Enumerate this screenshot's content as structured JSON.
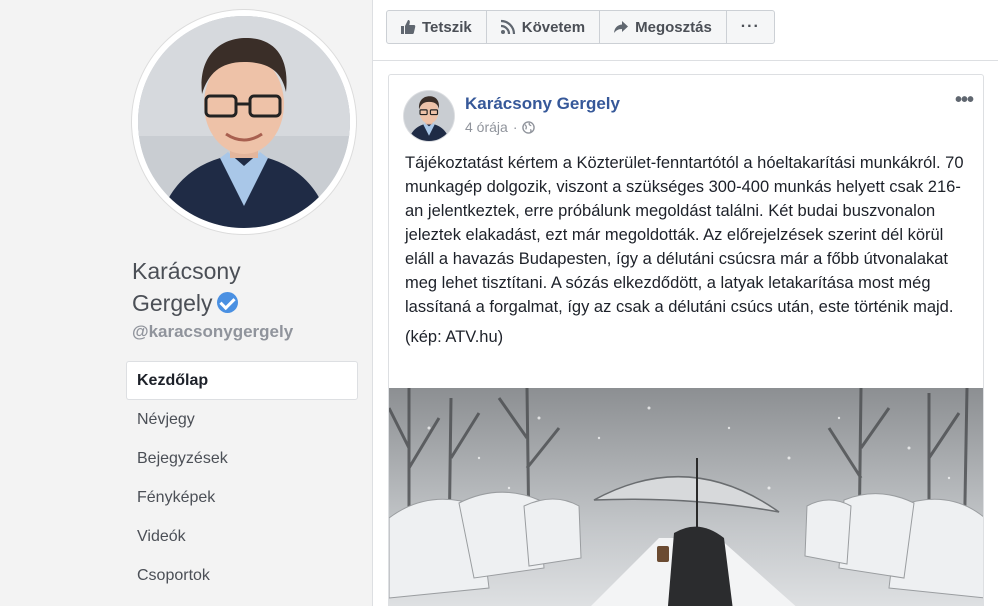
{
  "profile": {
    "name_line1": "Karácsony",
    "name_line2": "Gergely",
    "handle": "@karacsonygergely"
  },
  "nav": {
    "items": [
      {
        "label": "Kezdőlap",
        "active": true
      },
      {
        "label": "Névjegy"
      },
      {
        "label": "Bejegyzések"
      },
      {
        "label": "Fényképek"
      },
      {
        "label": "Videók"
      },
      {
        "label": "Csoportok"
      }
    ]
  },
  "actions": {
    "like": "Tetszik",
    "follow": "Követem",
    "share": "Megosztás",
    "more": "···"
  },
  "post": {
    "author": "Karácsony Gergely",
    "time": "4 órája",
    "separator": "·",
    "body": "Tájékoztatást kértem a Közterület-fenntartótól a hóeltakarítási munkákról. 70 munkagép dolgozik, viszont a szükséges 300-400 munkás helyett csak 216-an jelentkeztek, erre próbálunk megoldást találni. Két budai buszvonalon jeleztek elakadást, ezt már megoldották. Az előrejelzések szerint dél körül eláll a havazás Budapesten, így a délutáni csúcsra már a főbb útvonalakat meg lehet tisztítani. A sózás elkezdődött, a latyak letakarítása most még lassítaná a forgalmat, így az csak a délutáni csúcs után, este történik majd.",
    "caption": "(kép: ATV.hu)",
    "more": "•••"
  },
  "colors": {
    "link": "#365899",
    "verified": "#4a90e2",
    "background": "#e9ebee"
  }
}
